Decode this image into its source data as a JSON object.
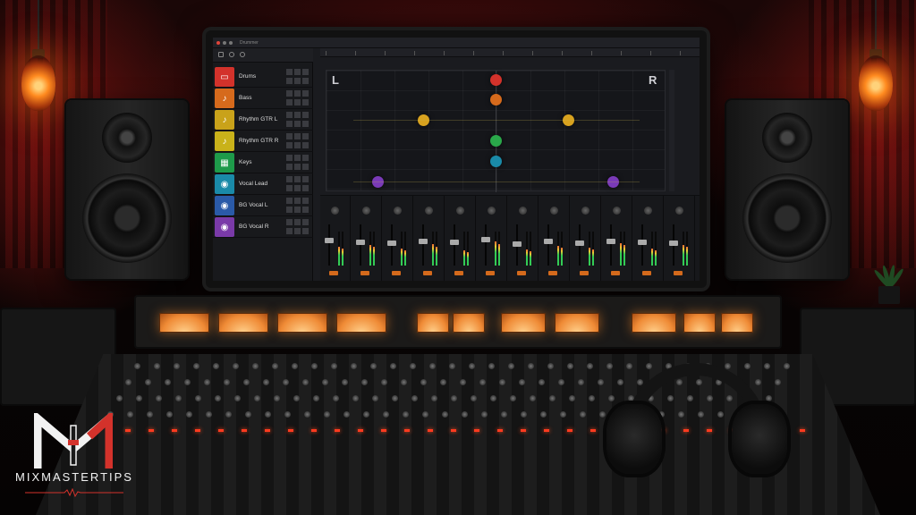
{
  "daw": {
    "document_name": "Drummer",
    "pan_labels": {
      "left": "L",
      "right": "R"
    },
    "tracks": [
      {
        "name": "Drums",
        "color": "#d3322b",
        "icon": "drum-icon",
        "glyph": "▭"
      },
      {
        "name": "Bass",
        "color": "#d66a1c",
        "icon": "bass-guitar-icon",
        "glyph": "♪"
      },
      {
        "name": "Rhythm GTR L",
        "color": "#c9a21a",
        "icon": "guitar-icon",
        "glyph": "♪"
      },
      {
        "name": "Rhythm GTR R",
        "color": "#c9b21a",
        "icon": "guitar-icon",
        "glyph": "♪"
      },
      {
        "name": "Keys",
        "color": "#1e9a4a",
        "icon": "keyboard-icon",
        "glyph": "▦"
      },
      {
        "name": "Vocal Lead",
        "color": "#1a8aa8",
        "icon": "microphone-icon",
        "glyph": "◉"
      },
      {
        "name": "BG Vocal L",
        "color": "#2a5aa8",
        "icon": "microphone-icon",
        "glyph": "◉"
      },
      {
        "name": "BG Vocal R",
        "color": "#7a3aa8",
        "icon": "microphone-icon",
        "glyph": "◉"
      }
    ],
    "pan_positions": [
      {
        "track": "Drums",
        "pan": 0.0,
        "color": "#d3322b"
      },
      {
        "track": "Bass",
        "pan": 0.0,
        "color": "#d66a1c"
      },
      {
        "track": "Rhythm GTR L",
        "pan": -0.45,
        "color": "#d8a21f"
      },
      {
        "track": "Rhythm GTR R",
        "pan": 0.45,
        "color": "#d8a21f"
      },
      {
        "track": "Keys",
        "pan": 0.0,
        "color": "#2aa84a"
      },
      {
        "track": "Vocal Lead",
        "pan": 0.0,
        "color": "#1a8aa8"
      },
      {
        "track": "BG Vocal L",
        "pan": -0.73,
        "color": "#7a3ab8"
      },
      {
        "track": "BG Vocal R",
        "pan": 0.73,
        "color": "#7a3ab8"
      }
    ],
    "mixer_levels": [
      0.62,
      0.58,
      0.55,
      0.6,
      0.57,
      0.64,
      0.52,
      0.6,
      0.56,
      0.6,
      0.58,
      0.55
    ],
    "meter_levels": [
      0.55,
      0.6,
      0.5,
      0.62,
      0.45,
      0.7,
      0.48,
      0.58,
      0.52,
      0.66,
      0.5,
      0.6
    ]
  },
  "logo": {
    "text": "MIXMASTERTIPS",
    "color": "#d3322b"
  }
}
